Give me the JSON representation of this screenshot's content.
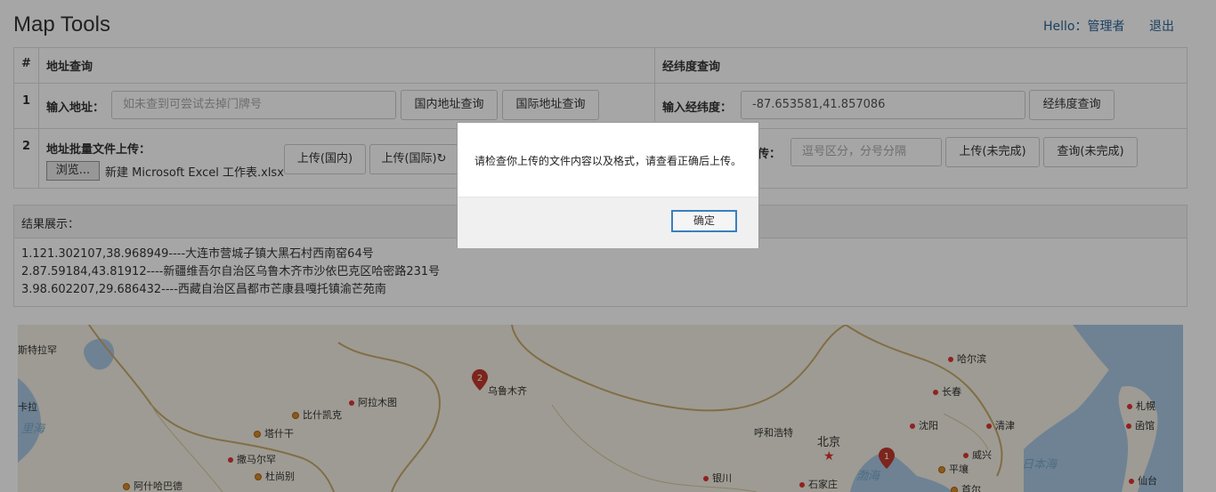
{
  "header": {
    "title": "Map Tools",
    "hello": "Hello：管理者",
    "logout": "退出"
  },
  "table": {
    "col_num": "#",
    "col_address": "地址查询",
    "col_coord": "经纬度查询",
    "row1": {
      "num": "1",
      "address_label": "输入地址：",
      "address_placeholder": "如未查到可尝试去掉门牌号",
      "domestic_button": "国内地址查询",
      "international_button": "国际地址查询",
      "coord_label": "输入经纬度：",
      "coord_value": "-87.653581,41.857086",
      "coord_button": "经纬度查询"
    },
    "row2": {
      "num": "2",
      "batch_label": "地址批量文件上传：",
      "browse_button": "浏览...",
      "file_name": "新建 Microsoft Excel 工作表.xlsx",
      "upload_domestic": "上传(国内)",
      "upload_international": "上传(国际)",
      "coord_upload_label": "传：",
      "coord_upload_placeholder": "逗号区分，分号分隔",
      "upload_unfinished": "上传(未完成)",
      "query_unfinished": "查询(未完成)"
    }
  },
  "result": {
    "heading": "结果展示：",
    "lines": [
      "1.121.302107,38.968949----大连市营城子镇大黑石村西南窑64号",
      "2.87.59184,43.81912----新疆维吾尔自治区乌鲁木齐市沙依巴克区哈密路231号",
      "3.98.602207,29.686432----西藏自治区昌都市芒康县嘎托镇渝芒苑南"
    ]
  },
  "map": {
    "cities": [
      {
        "name": "斯特拉罕",
        "kind": "none"
      },
      {
        "name": "阿拉木图",
        "kind": "red"
      },
      {
        "name": "乌鲁木齐",
        "kind": "none"
      },
      {
        "name": "比什凯克",
        "kind": "orange"
      },
      {
        "name": "塔什干",
        "kind": "orange"
      },
      {
        "name": "撒马尔罕",
        "kind": "red"
      },
      {
        "name": "杜尚别",
        "kind": "orange"
      },
      {
        "name": "阿什哈巴德",
        "kind": "orange"
      },
      {
        "name": "哈尔滨",
        "kind": "red"
      },
      {
        "name": "长春",
        "kind": "red"
      },
      {
        "name": "沈阳",
        "kind": "red"
      },
      {
        "name": "呼和浩特",
        "kind": "red"
      },
      {
        "name": "北京",
        "kind": "none"
      },
      {
        "name": "银川",
        "kind": "red"
      },
      {
        "name": "石家庄",
        "kind": "red"
      },
      {
        "name": "清津",
        "kind": "red"
      },
      {
        "name": "威兴",
        "kind": "red"
      },
      {
        "name": "平壤",
        "kind": "orange"
      },
      {
        "name": "首尔",
        "kind": "orange"
      },
      {
        "name": "札幌",
        "kind": "red"
      },
      {
        "name": "函馆",
        "kind": "red"
      },
      {
        "name": "仙台",
        "kind": "red"
      },
      {
        "name": "卡拉",
        "kind": "none"
      }
    ],
    "seas": [
      "里海",
      "日本海",
      "渤海"
    ],
    "markers": [
      "1",
      "2"
    ]
  },
  "dialog": {
    "message": "请检查你上传的文件内容以及格式，请查看正确后上传。",
    "ok_button": "确定"
  },
  "colors": {
    "link": "#2a6496",
    "map_land": "#f2eee2",
    "map_water": "#a9c8e3",
    "marker": "#c0392b"
  }
}
